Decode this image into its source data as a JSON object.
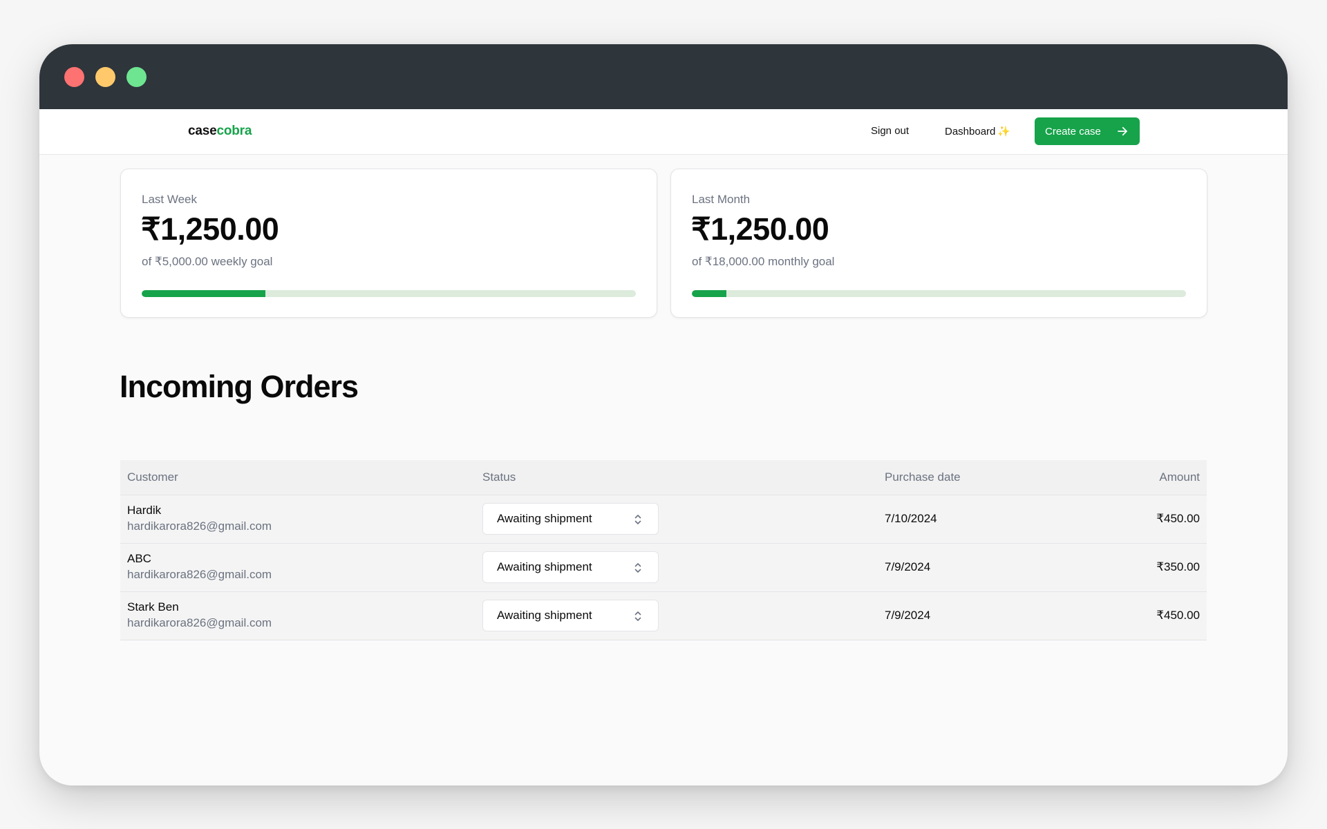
{
  "navbar": {
    "logo_case": "case",
    "logo_cobra": "cobra",
    "sign_out": "Sign out",
    "dashboard": "Dashboard",
    "dashboard_sparkle": "✨",
    "create_case": "Create case"
  },
  "stats": {
    "week": {
      "label": "Last Week",
      "amount": "₹1,250.00",
      "goal": "of ₹5,000.00 weekly goal",
      "progress_percent": 25
    },
    "month": {
      "label": "Last Month",
      "amount": "₹1,250.00",
      "goal": "of ₹18,000.00 monthly goal",
      "progress_percent": 7
    }
  },
  "orders": {
    "title": "Incoming Orders",
    "columns": {
      "customer": "Customer",
      "status": "Status",
      "purchase_date": "Purchase date",
      "amount": "Amount"
    },
    "rows": [
      {
        "name": "Hardik",
        "email": "hardikarora826@gmail.com",
        "status": "Awaiting shipment",
        "date": "7/10/2024",
        "amount": "₹450.00"
      },
      {
        "name": "ABC",
        "email": "hardikarora826@gmail.com",
        "status": "Awaiting shipment",
        "date": "7/9/2024",
        "amount": "₹350.00"
      },
      {
        "name": "Stark Ben",
        "email": "hardikarora826@gmail.com",
        "status": "Awaiting shipment",
        "date": "7/9/2024",
        "amount": "₹450.00"
      }
    ]
  },
  "colors": {
    "accent": "#16a34a",
    "titlebar": "#2e353b",
    "progress_track": "#dcebdc"
  }
}
